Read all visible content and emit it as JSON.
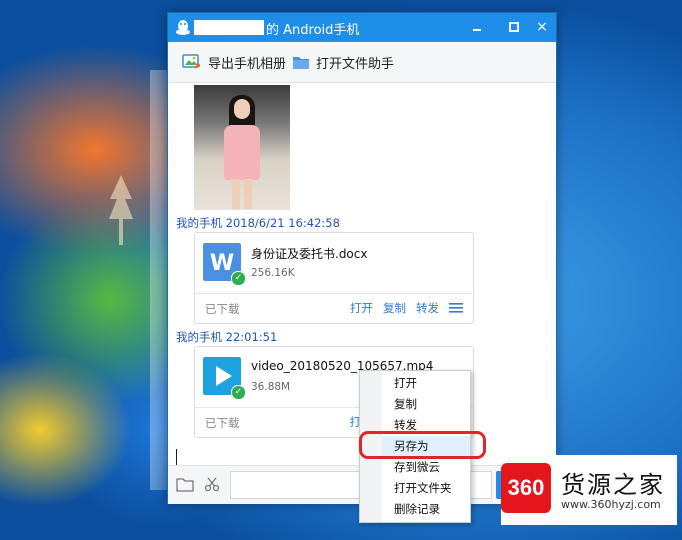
{
  "window": {
    "title": "的 Android手机",
    "controls": {
      "close": "×"
    }
  },
  "toolbar": {
    "export_album": "导出手机相册",
    "open_file_helper": "打开文件助手"
  },
  "messages": [
    {
      "sender": "我的手机 2018/6/21 16:42:58",
      "file_name": "身份证及委托书.docx",
      "file_size": "256.16K",
      "status": "已下载",
      "actions": [
        "打开",
        "复制",
        "转发"
      ],
      "icon": "word-doc-icon",
      "icon_color": "#4a90e2"
    },
    {
      "sender": "我的手机  22:01:51",
      "file_name": "video_20180520_105657.mp4",
      "file_size": "36.88M",
      "status": "已下载",
      "actions": [
        "打"
      ],
      "icon": "video-play-icon",
      "icon_color": "#1ea2e0"
    }
  ],
  "context_menu": {
    "items": [
      "打开",
      "复制",
      "转发",
      "另存为",
      "存到微云",
      "打开文件夹",
      "删除记录"
    ],
    "highlighted": "另存为"
  },
  "watermark": {
    "badge": "360",
    "title": "货源之家",
    "url": "www.360hyzj.com"
  },
  "colors": {
    "accent": "#1e8ee8",
    "link": "#2f7bd8",
    "sender": "#2155b8",
    "highlight_ring": "#e0262a",
    "check": "#2fae51"
  }
}
